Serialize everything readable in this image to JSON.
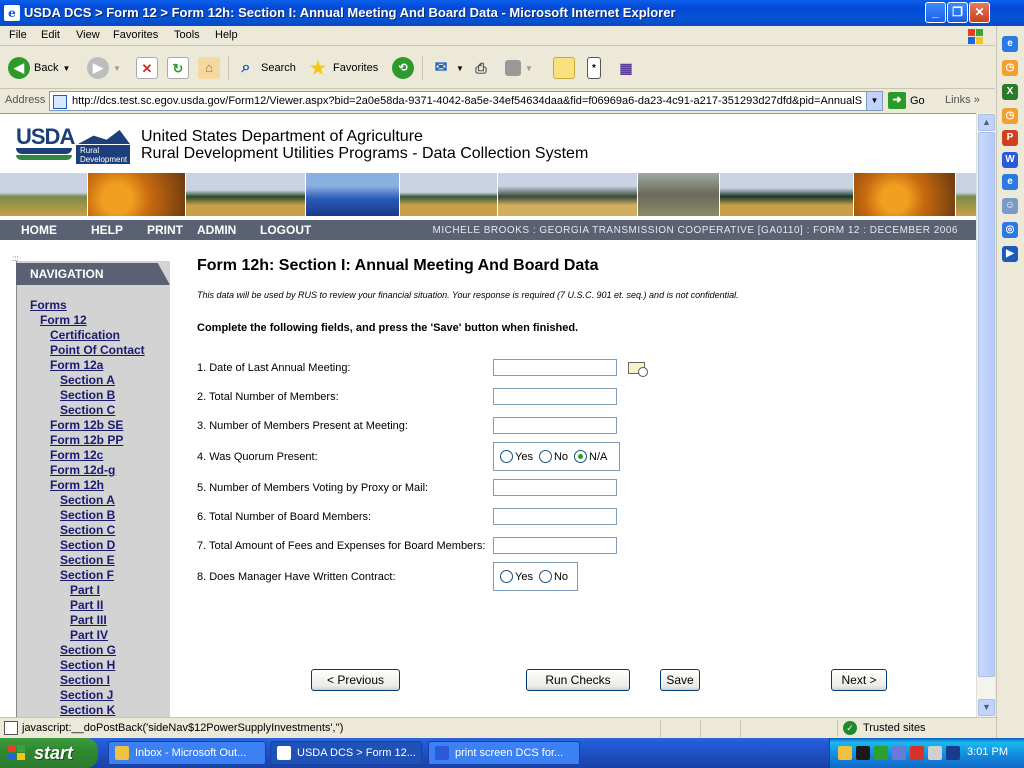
{
  "window": {
    "title": "USDA DCS > Form 12 > Form 12h: Section I: Annual Meeting And Board Data - Microsoft Internet Explorer"
  },
  "menu": [
    "File",
    "Edit",
    "View",
    "Favorites",
    "Tools",
    "Help"
  ],
  "toolbar": {
    "back": "Back",
    "search": "Search",
    "favorites": "Favorites"
  },
  "address": {
    "label": "Address",
    "url": "http://dcs.test.sc.egov.usda.gov/Form12/Viewer.aspx?bid=2a0e58da-9371-4042-8a5e-34ef54634daa&fid=f06969a6-da23-4c91-a217-351293d27dfd&pid=AnnualS",
    "go": "Go",
    "links": "Links"
  },
  "site": {
    "logo_text": "USDA",
    "logo_sub": "Rural Development",
    "title_line1": "United States Department of Agriculture",
    "title_line2": "Rural Development Utilities Programs - Data Collection System"
  },
  "topnav": {
    "items": [
      "HOME",
      "HELP",
      "PRINT",
      "ADMIN",
      "LOGOUT"
    ],
    "user_info": "MICHELE BROOKS : GEORGIA TRANSMISSION COOPERATIVE [GA0110] : FORM 12 : DECEMBER 2006"
  },
  "navigation": {
    "header": "NAVIGATION",
    "links": [
      "Forms",
      "Form 12",
      "Certification",
      "Point Of Contact",
      "Form 12a",
      "Section A",
      "Section B",
      "Section C",
      "Form 12b SE",
      "Form 12b PP",
      "Form 12c",
      "Form 12d-g",
      "Form 12h",
      "Section A",
      "Section B",
      "Section C",
      "Section D",
      "Section E",
      "Section F",
      "Part I",
      "Part II",
      "Part III",
      "Part IV",
      "Section G",
      "Section H",
      "Section I",
      "Section J",
      "Section K"
    ]
  },
  "form": {
    "title": "Form 12h: Section I: Annual Meeting And Board Data",
    "description": "This data will be used by RUS to review your financial situation. Your response is required (7 U.S.C. 901 et. seq.) and is not confidential.",
    "instructions": "Complete the following fields, and press the 'Save' button when finished.",
    "questions": [
      {
        "label": "1. Date of Last Annual Meeting:",
        "value": ""
      },
      {
        "label": "2. Total Number of Members:",
        "value": ""
      },
      {
        "label": "3. Number of Members Present at Meeting:",
        "value": ""
      },
      {
        "label": "4. Was Quorum Present:",
        "options": [
          "Yes",
          "No",
          "N/A"
        ],
        "selected": "N/A"
      },
      {
        "label": "5. Number of Members Voting by Proxy or Mail:",
        "value": ""
      },
      {
        "label": "6. Total Number of Board Members:",
        "value": ""
      },
      {
        "label": "7. Total Amount of Fees and Expenses for Board Members:",
        "value": ""
      },
      {
        "label": "8. Does Manager Have Written Contract:",
        "options": [
          "Yes",
          "No"
        ],
        "selected": ""
      }
    ],
    "buttons": {
      "previous": "< Previous",
      "run_checks": "Run Checks",
      "save": "Save",
      "next": "Next >"
    }
  },
  "status": {
    "text": "javascript:__doPostBack('sideNav$12PowerSupplyInvestments','')",
    "zone": "Trusted sites"
  },
  "taskbar": {
    "start": "start",
    "tasks": [
      "Inbox - Microsoft Out...",
      "USDA DCS > Form 12...",
      "print screen DCS for..."
    ],
    "clock": "3:01 PM"
  },
  "colors": {
    "nav_bar": "#5a6173",
    "nav_panel": "#d3d3d3",
    "link": "#1a1a6e"
  }
}
